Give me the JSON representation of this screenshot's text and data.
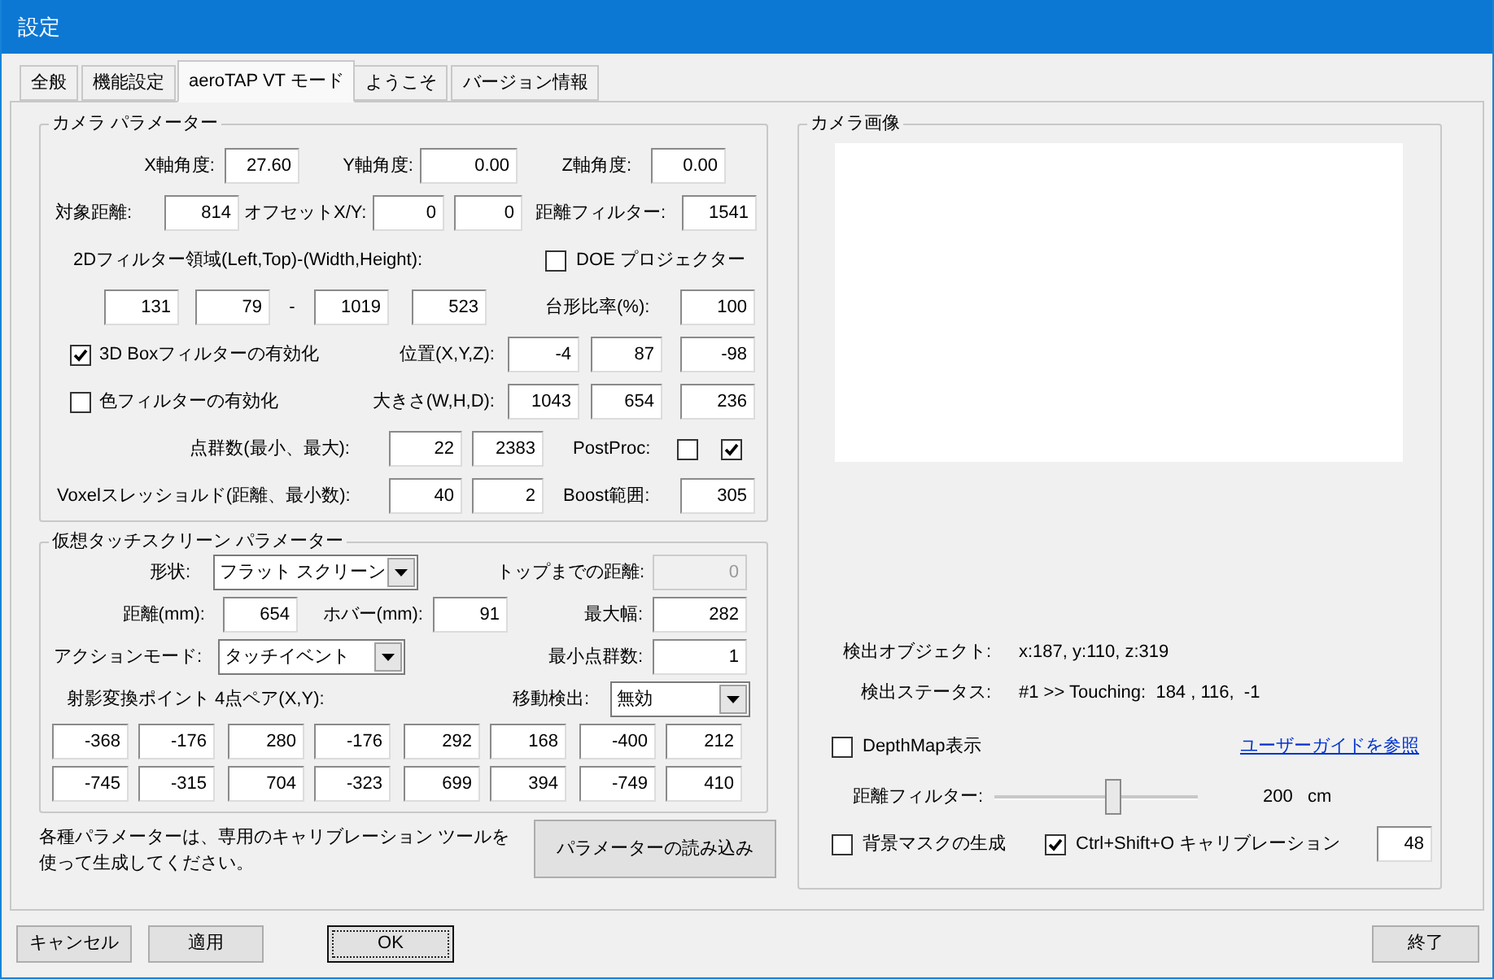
{
  "window": {
    "title": "設定"
  },
  "tabs": [
    {
      "label": "全般",
      "selected": false
    },
    {
      "label": "機能設定",
      "selected": false
    },
    {
      "label": "aeroTAP VT モード",
      "selected": true
    },
    {
      "label": "ようこそ",
      "selected": false
    },
    {
      "label": "バージョン情報",
      "selected": false
    }
  ],
  "camera_params": {
    "title": "カメラ パラメーター",
    "x_angle": {
      "label": "X軸角度:",
      "value": "27.60"
    },
    "y_angle": {
      "label": "Y軸角度:",
      "value": "0.00"
    },
    "z_angle": {
      "label": "Z軸角度:",
      "value": "0.00"
    },
    "target_distance": {
      "label": "対象距離:",
      "value": "814"
    },
    "offset": {
      "label": "オフセットX/Y:",
      "values": [
        "0",
        "0"
      ]
    },
    "distance_filter": {
      "label": "距離フィルター:",
      "value": "1541"
    },
    "filter_2d": {
      "label": "2Dフィルター領域(Left,Top)-(Width,Height):",
      "values": [
        "131",
        "79",
        "1019",
        "523"
      ],
      "separator": "-"
    },
    "doe_projector": {
      "label": "DOE プロジェクター",
      "checked": false
    },
    "trapezoid": {
      "label": "台形比率(%):",
      "value": "100"
    },
    "box_filter": {
      "label": "3D Boxフィルターの有効化",
      "checked": true
    },
    "position": {
      "label": "位置(X,Y,Z):",
      "values": [
        "-4",
        "87",
        "-98"
      ]
    },
    "color_filter": {
      "label": "色フィルターの有効化",
      "checked": false
    },
    "size": {
      "label": "大きさ(W,H,D):",
      "values": [
        "1043",
        "654",
        "236"
      ]
    },
    "point_count": {
      "label": "点群数(最小、最大):",
      "values": [
        "22",
        "2383"
      ]
    },
    "postproc": {
      "label": "PostProc:",
      "options": [
        {
          "checked": false
        },
        {
          "checked": true
        }
      ]
    },
    "voxel": {
      "label": "Voxelスレッショルド(距離、最小数):",
      "values": [
        "40",
        "2"
      ]
    },
    "boost": {
      "label": "Boost範囲:",
      "value": "305"
    }
  },
  "touchscreen": {
    "title": "仮想タッチスクリーン パラメーター",
    "shape": {
      "label": "形状:",
      "value": "フラット スクリーン"
    },
    "top_distance": {
      "label": "トップまでの距離:",
      "value": "0",
      "disabled": true
    },
    "distance": {
      "label": "距離(mm):",
      "value": "654"
    },
    "hover": {
      "label": "ホバー(mm):",
      "value": "91"
    },
    "max_width": {
      "label": "最大幅:",
      "value": "282"
    },
    "action_mode": {
      "label": "アクションモード:",
      "value": "タッチイベント"
    },
    "min_points": {
      "label": "最小点群数:",
      "value": "1"
    },
    "projection": {
      "label": "射影変換ポイント 4点ペア(X,Y):",
      "rows": [
        [
          "-368",
          "-176",
          "280",
          "-176",
          "292",
          "168",
          "-400",
          "212"
        ],
        [
          "-745",
          "-315",
          "704",
          "-323",
          "699",
          "394",
          "-749",
          "410"
        ]
      ]
    },
    "motion": {
      "label": "移動検出:",
      "value": "無効"
    }
  },
  "note": "各種パラメーターは、専用のキャリブレーション ツールを使って生成してください。",
  "load_button": "パラメーターの読み込み",
  "camera_image": {
    "title": "カメラ画像",
    "detected_object": {
      "label": "検出オブジェクト:",
      "value": "x:187, y:110, z:319"
    },
    "detection_status": {
      "label": "検出ステータス:",
      "value": "#1 >> Touching:  184 , 116,  -1"
    },
    "depthmap": {
      "label": "DepthMap表示",
      "checked": false
    },
    "guide_link": "ユーザーガイドを参照",
    "distance_filter": {
      "label": "距離フィルター:",
      "level": 0.58,
      "reading": "200   cm"
    },
    "bg_mask": {
      "label": "背景マスクの生成",
      "checked": false
    },
    "calibration": {
      "label": "Ctrl+Shift+O キャリブレーション",
      "checked": true
    },
    "calibration_value": "48"
  },
  "buttons": [
    {
      "label": "キャンセル",
      "default": false
    },
    {
      "label": "適用",
      "default": false
    },
    {
      "label": "OK",
      "default": true
    }
  ],
  "exit_button": "終了"
}
